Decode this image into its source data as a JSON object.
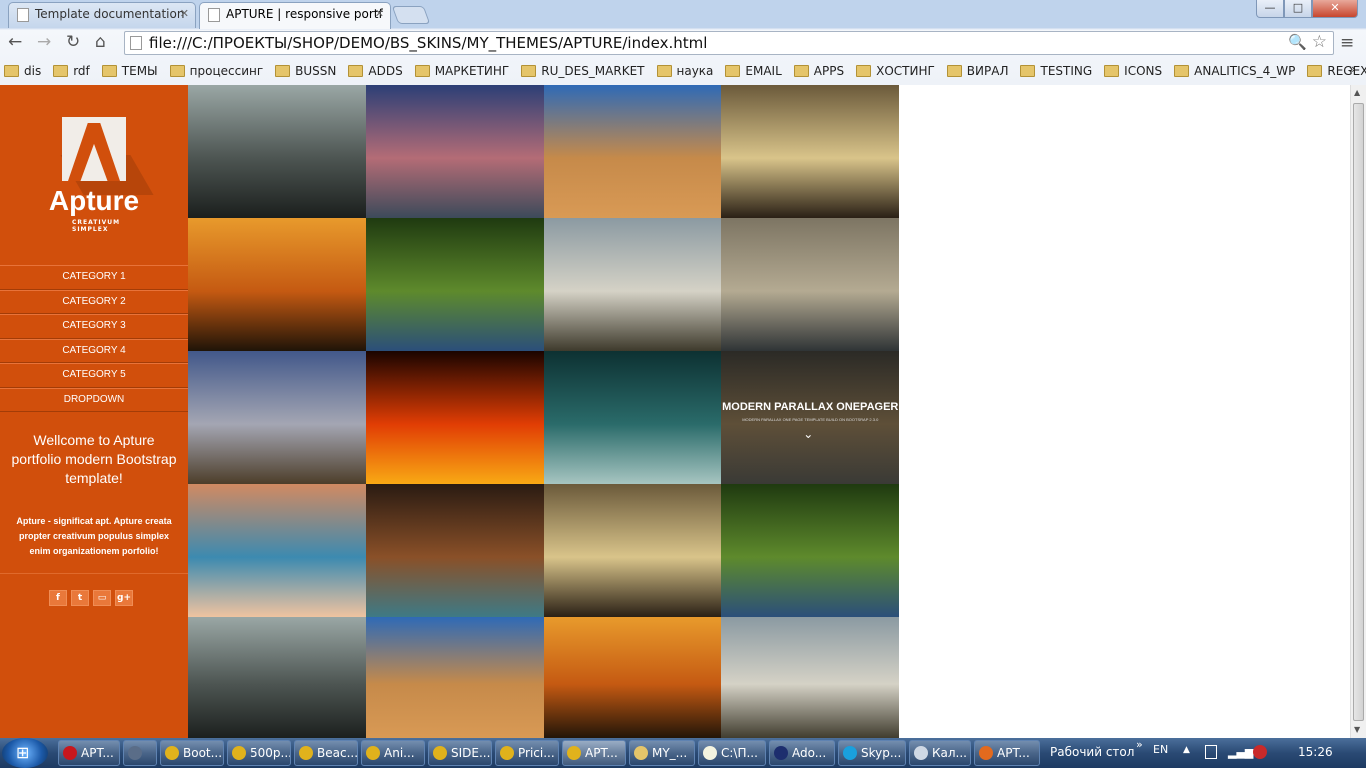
{
  "browser": {
    "tabs": [
      {
        "label": "Template documentation",
        "active": false
      },
      {
        "label": "APTURE | responsive portf",
        "active": true
      }
    ],
    "address": "file:///C:/ПРОЕКТЫ/SHOP/DEMO/BS_SKINS/MY_THEMES/APTURE/index.html",
    "window_buttons": {
      "minimize": "—",
      "maximize": "□",
      "close": "✕"
    },
    "nav": {
      "back": "←",
      "forward": "→",
      "reload": "↻",
      "home": "⌂",
      "zoom": "🔍",
      "star": "☆",
      "menu": "≡"
    },
    "bookmarks": [
      "dis",
      "rdf",
      "ТЕМЫ",
      "процессинг",
      "BUSSN",
      "ADDS",
      "МАРКЕТИНГ",
      "RU_DES_MARKET",
      "наука",
      "EMAIL",
      "APPS",
      "ХОСТИНГ",
      "ВИРАЛ",
      "TESTING",
      "ICONS",
      "ANALITICS_4_WP",
      "REGEXP"
    ],
    "bookmarks_more": "»"
  },
  "sidebar": {
    "logo_name": "Apture",
    "logo_tagline": "CREATIVUM SIMPLEX",
    "categories": [
      "CATEGORY 1",
      "CATEGORY 2",
      "CATEGORY 3",
      "CATEGORY 4",
      "CATEGORY 5",
      "DROPDOWN"
    ],
    "welcome": "Wellcome to Apture portfolio modern Bootstrap template!",
    "description": "Apture - significat apt. Apture creata propter creativum populus simplex enim organizationem porfolio!",
    "social": [
      {
        "name": "facebook-icon",
        "glyph": "f"
      },
      {
        "name": "twitter-icon",
        "glyph": "t"
      },
      {
        "name": "flickr-icon",
        "glyph": "▭"
      },
      {
        "name": "google-plus-icon",
        "glyph": "g+"
      }
    ]
  },
  "gallery": {
    "tiles": [
      {
        "name": "beach-reflection",
        "c": [
          "#9aa7a5",
          "#4d5552",
          "#1b1f1d"
        ]
      },
      {
        "name": "rocky-coast-sunset",
        "c": [
          "#2c3f76",
          "#b46c76",
          "#3c4a5a"
        ]
      },
      {
        "name": "desert-dune",
        "c": [
          "#2f6ab6",
          "#c68a4a",
          "#d99a55"
        ]
      },
      {
        "name": "boats-sunburst",
        "c": [
          "#6b5a3b",
          "#d9c48a",
          "#2a2015"
        ]
      },
      {
        "name": "mountain-sunset",
        "c": [
          "#e89a2c",
          "#c55a12",
          "#1f1408"
        ]
      },
      {
        "name": "seagulls-motion",
        "c": [
          "#1f3a10",
          "#5e8a2c",
          "#2b4f7a"
        ]
      },
      {
        "name": "river-valley",
        "c": [
          "#8b9aa2",
          "#d5d2c6",
          "#3e3a2c"
        ]
      },
      {
        "name": "stormy-coast",
        "c": [
          "#7d7563",
          "#b4aa92",
          "#2f3436"
        ]
      },
      {
        "name": "lake-clouds",
        "c": [
          "#42588a",
          "#a4a6b3",
          "#4d3e2a"
        ]
      },
      {
        "name": "solar-surface",
        "c": [
          "#1a0400",
          "#e13d04",
          "#f9a914"
        ]
      },
      {
        "name": "subway-tunnel",
        "c": [
          "#0d3132",
          "#2a6b6a",
          "#a7c5c1"
        ]
      },
      {
        "name": "parallax-template",
        "c": [
          "#2b2a26",
          "#5e4f38",
          "#3a3a36"
        ]
      },
      {
        "name": "canyon-stones",
        "c": [
          "#d18a62",
          "#3c8ab0",
          "#f0c3a0"
        ]
      },
      {
        "name": "cave-rock",
        "c": [
          "#2a1b12",
          "#8a5028",
          "#3e7a86"
        ]
      },
      {
        "name": "boats-sunburst-2",
        "c": [
          "#6b5a3b",
          "#d9c48a",
          "#2a2015"
        ]
      },
      {
        "name": "seagulls-motion-2",
        "c": [
          "#1f3a10",
          "#5e8a2c",
          "#2b4f7a"
        ]
      },
      {
        "name": "beach-reflection-2",
        "c": [
          "#9aa7a5",
          "#4d5552",
          "#1b1f1d"
        ]
      },
      {
        "name": "desert-dune-2",
        "c": [
          "#2f6ab6",
          "#c68a4a",
          "#d99a55"
        ]
      },
      {
        "name": "mountain-sunset-2",
        "c": [
          "#e89a2c",
          "#c55a12",
          "#1f1408"
        ]
      },
      {
        "name": "river-valley-2",
        "c": [
          "#8b9aa2",
          "#d5d2c6",
          "#3e3a2c"
        ]
      }
    ],
    "parallax_title": "MODERN PARALLAX ONEPAGER",
    "parallax_sub": "MODERN PARALLAX ONE PAGE TEMPLATE BUILD ON BOOTSRAP 2.3.0"
  },
  "taskbar": {
    "items": [
      {
        "label": "APT...",
        "color": "#c8171d"
      },
      {
        "label": "",
        "color": "#5a6d88"
      },
      {
        "label": "Boot...",
        "color": "#e0b21c"
      },
      {
        "label": "500p...",
        "color": "#e0b21c"
      },
      {
        "label": "Beac...",
        "color": "#e0b21c"
      },
      {
        "label": "Ani...",
        "color": "#e0b21c"
      },
      {
        "label": "SIDE...",
        "color": "#e0b21c"
      },
      {
        "label": "Prici...",
        "color": "#e0b21c"
      },
      {
        "label": "APT...",
        "color": "#e0b21c"
      },
      {
        "label": "MY_...",
        "color": "#e5c56a"
      },
      {
        "label": "C:\\П...",
        "color": "#f4f4e0"
      },
      {
        "label": "Ado...",
        "color": "#1d2e6e"
      },
      {
        "label": "Skyp...",
        "color": "#1aa0dd"
      },
      {
        "label": "Кал...",
        "color": "#cfd8e4"
      },
      {
        "label": "APT...",
        "color": "#e36a1e"
      }
    ],
    "desktop": "Рабочий стол",
    "lang": "EN",
    "clock": "15:26"
  }
}
